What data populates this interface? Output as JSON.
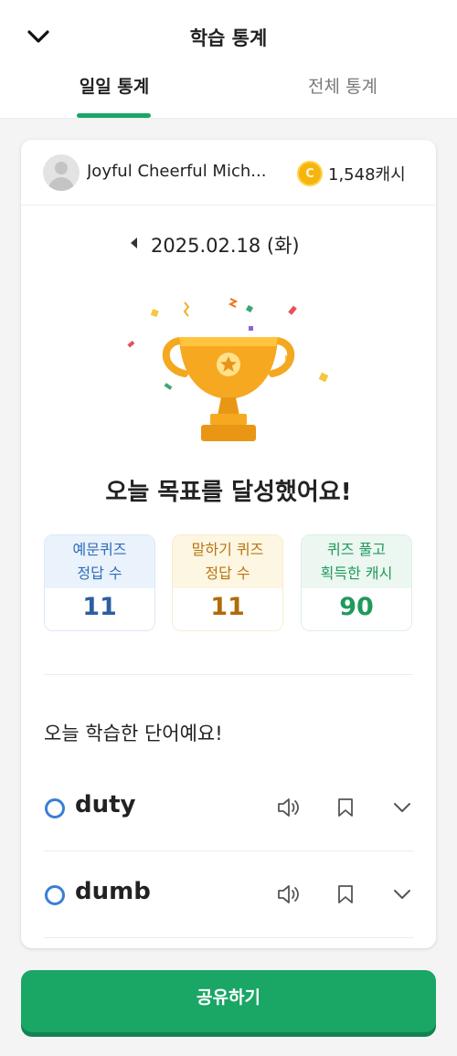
{
  "header": {
    "title": "학습 통계",
    "tabs": [
      {
        "label": "일일 통계",
        "active": true
      },
      {
        "label": "전체 통계",
        "active": false
      }
    ]
  },
  "profile": {
    "name": "Joyful Cheerful Mich...",
    "coin_symbol": "C",
    "cash": "1,548캐시"
  },
  "date": "2025.02.18 (화)",
  "goal_message": "오늘 목표를 달성했어요!",
  "stats": [
    {
      "line1": "예문퀴즈",
      "line2": "정답 수",
      "value": "11"
    },
    {
      "line1": "말하기 퀴즈",
      "line2": "정답 수",
      "value": "11"
    },
    {
      "line1": "퀴즈 풀고",
      "line2": "획득한 캐시",
      "value": "90"
    }
  ],
  "words_title": "오늘 학습한 단어예요!",
  "words": [
    {
      "word": "duty",
      "status": "correct"
    },
    {
      "word": "dumb",
      "status": "correct"
    }
  ],
  "share_button": "공유하기",
  "colors": {
    "accent": "#1aa665",
    "blue": "#2d6cb8",
    "orange": "#b87512",
    "green": "#1f9a5c",
    "coin": "#f6b40e"
  },
  "icons": [
    "chevron-down-icon",
    "avatar-icon",
    "coin-icon",
    "chevron-left-icon",
    "trophy-icon",
    "circle-icon",
    "speaker-icon",
    "bookmark-icon"
  ]
}
